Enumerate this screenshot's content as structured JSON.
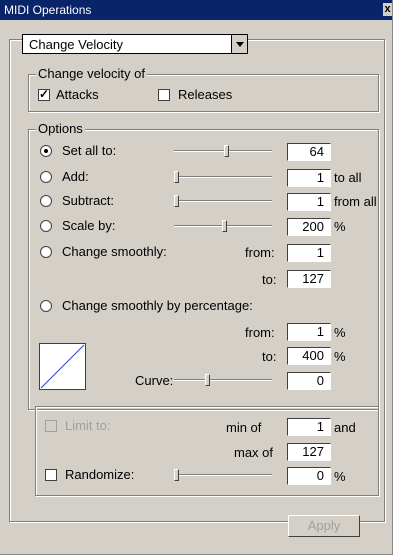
{
  "window": {
    "title": "MIDI Operations"
  },
  "operation": {
    "selected": "Change Velocity"
  },
  "velocity_group": {
    "label": "Change velocity of",
    "attacks": "Attacks",
    "releases": "Releases",
    "attacks_checked": true,
    "releases_checked": false
  },
  "options": {
    "label": "Options",
    "set_all": {
      "label": "Set all to:",
      "value": "64",
      "selected": true
    },
    "add": {
      "label": "Add:",
      "value": "1",
      "suffix": "to all"
    },
    "subtract": {
      "label": "Subtract:",
      "value": "1",
      "suffix": "from all"
    },
    "scale": {
      "label": "Scale by:",
      "value": "200",
      "suffix": "%"
    },
    "change_smoothly": {
      "label": "Change smoothly:",
      "from_label": "from:",
      "from_value": "1",
      "to_label": "to:",
      "to_value": "127"
    },
    "change_smoothly_pct": {
      "label": "Change smoothly by percentage:",
      "from_label": "from:",
      "from_value": "1",
      "from_suffix": "%",
      "to_label": "to:",
      "to_value": "400",
      "to_suffix": "%"
    },
    "curve": {
      "label": "Curve:",
      "value": "0"
    }
  },
  "limits": {
    "limit_to": "Limit to:",
    "min_label": "min of",
    "min_value": "1",
    "min_suffix": "and",
    "max_label": "max of",
    "max_value": "127",
    "randomize": "Randomize:",
    "randomize_value": "0",
    "randomize_suffix": "%"
  },
  "apply_label": "Apply",
  "close_glyph": "x"
}
